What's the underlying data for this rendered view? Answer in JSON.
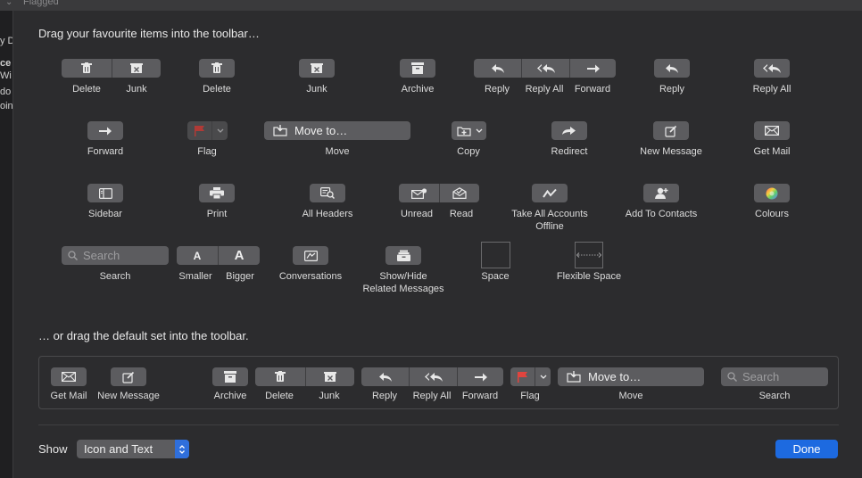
{
  "background": {
    "window_title": "Flagged",
    "sidebar_fragments": [
      "y D",
      "ce",
      "Wi",
      "do",
      "oin"
    ]
  },
  "header": {
    "instruction": "Drag your favourite items into the toolbar…"
  },
  "items": {
    "delete_junk": {
      "left_label": "Delete",
      "right_label": "Junk"
    },
    "delete": {
      "label": "Delete"
    },
    "junk": {
      "label": "Junk"
    },
    "archive": {
      "label": "Archive"
    },
    "reply_group": {
      "reply": "Reply",
      "reply_all": "Reply All",
      "forward": "Forward"
    },
    "reply": {
      "label": "Reply"
    },
    "reply_all": {
      "label": "Reply All"
    },
    "forward": {
      "label": "Forward"
    },
    "flag": {
      "label": "Flag"
    },
    "move": {
      "button_text": "Move to…",
      "label": "Move"
    },
    "copy": {
      "label": "Copy"
    },
    "redirect": {
      "label": "Redirect"
    },
    "new_message": {
      "label": "New Message"
    },
    "get_mail": {
      "label": "Get Mail"
    },
    "sidebar": {
      "label": "Sidebar"
    },
    "print": {
      "label": "Print"
    },
    "all_headers": {
      "label": "All Headers"
    },
    "unread_read": {
      "unread": "Unread",
      "read": "Read"
    },
    "take_all_accounts_offline": {
      "line1": "Take All Accounts",
      "line2": "Offline"
    },
    "add_to_contacts": {
      "label": "Add To Contacts"
    },
    "colours": {
      "label": "Colours"
    },
    "search": {
      "placeholder": "Search",
      "label": "Search"
    },
    "smaller_bigger": {
      "smaller": "Smaller",
      "bigger": "Bigger",
      "glyph": "A"
    },
    "conversations": {
      "label": "Conversations"
    },
    "show_hide_related": {
      "line1": "Show/Hide",
      "line2": "Related Messages"
    },
    "space": {
      "label": "Space"
    },
    "flexible_space": {
      "label": "Flexible Space"
    }
  },
  "default_set": {
    "instruction": "… or drag the default set into the toolbar.",
    "get_mail": "Get Mail",
    "new_message": "New Message",
    "archive": "Archive",
    "delete": "Delete",
    "junk": "Junk",
    "reply": "Reply",
    "reply_all": "Reply All",
    "forward": "Forward",
    "flag": "Flag",
    "move_button": "Move to…",
    "move": "Move",
    "search_placeholder": "Search",
    "search": "Search"
  },
  "footer": {
    "show_label": "Show",
    "show_value": "Icon and Text",
    "done_label": "Done"
  },
  "colors": {
    "accent": "#1d6ae0",
    "flag_red": "#e0443e",
    "button": "#5c5c5f"
  }
}
